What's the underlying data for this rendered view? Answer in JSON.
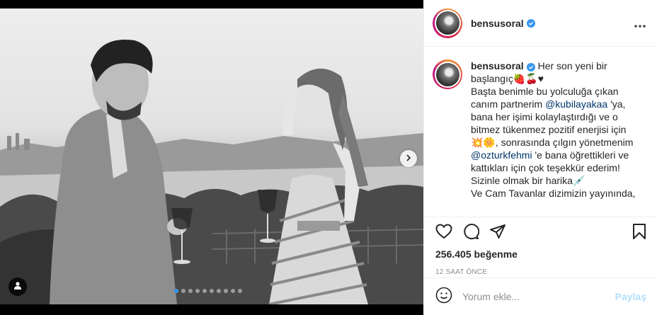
{
  "post": {
    "username": "bensusoral",
    "caption_lines": [
      "Her son yeni bir",
      "başlangıç🍓🍒♥",
      "Başta benimle bu yolculuğa çıkan",
      "canım partnerim ",
      "@kubilayakaa",
      " 'ya,",
      "bana her işimi kolaylaştırdığı ve o",
      "bitmez tükenmez pozitif enerjisi için",
      "💥🌼, sonrasında çılgın yönetmenim",
      "@ozturkfehmi",
      " 'e bana öğrettikleri ve",
      "kattıkları için çok teşekkür ederim!",
      "Sizinle olmak bir harika💉",
      "Ve Cam Tavanlar dizimizin yayınında,"
    ],
    "likes": "256.405 beğenme",
    "time_ago": "12 SAAT ÖNCE",
    "carousel": {
      "count": 10,
      "active_index": 0
    }
  },
  "comment": {
    "placeholder": "Yorum ekle...",
    "post_label": "Paylaş"
  },
  "colors": {
    "accent": "#3897f0",
    "mention": "#00376b",
    "muted": "#8e8e8e",
    "post_disabled": "#b2dffc"
  },
  "icons": [
    "more-options-icon",
    "verified-badge-icon",
    "heart-icon",
    "comment-icon",
    "share-icon",
    "bookmark-icon",
    "emoji-icon",
    "user-tag-icon",
    "chevron-right-icon"
  ]
}
